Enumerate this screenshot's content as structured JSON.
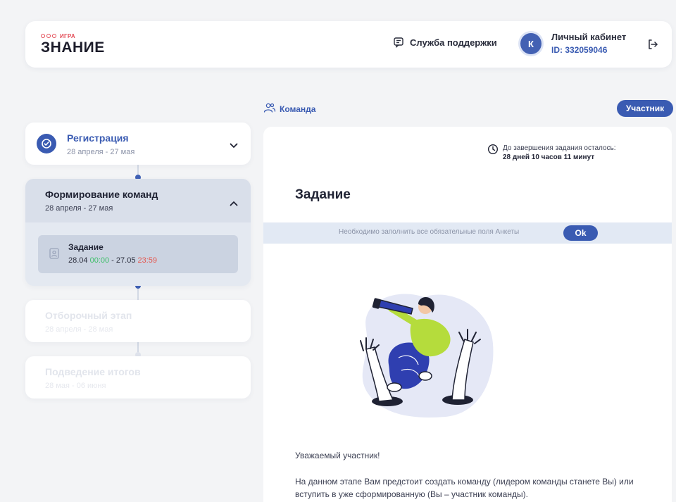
{
  "header": {
    "logo_top": "ИГРА",
    "logo_main": "ЗНАНИЕ",
    "support_label": "Служба поддержки",
    "avatar_initial": "К",
    "account_label": "Личный кабинет",
    "account_id": "ID: 332059046"
  },
  "sidebar": {
    "steps": [
      {
        "title": "Регистрация",
        "dates": "28 апреля - 27 мая",
        "state": "completed"
      },
      {
        "title": "Формирование команд",
        "dates": "28 апреля - 27 мая",
        "state": "active"
      },
      {
        "title": "Отборочный этап",
        "dates": "28 апреля - 28 мая",
        "state": "locked"
      },
      {
        "title": "Подведение итогов",
        "dates": "28 мая - 06 июня",
        "state": "locked"
      }
    ],
    "task": {
      "title": "Задание",
      "start_date": "28.04",
      "start_time": "00:00",
      "separator": " - ",
      "end_date": "27.05",
      "end_time": "23:59"
    }
  },
  "main": {
    "team_link": "Команда",
    "role_badge": "Участник",
    "timer_label": "До завершения задания осталось:",
    "timer_value": "28 дней 10 часов 11 минут",
    "title": "Задание",
    "notice": "Необходимо заполнить все обязательные поля Анкеты",
    "ok_label": "Ok",
    "greeting": "Уважаемый участник!",
    "description": "На данном этапе Вам предстоит создать команду (лидером команды станете Вы) или вступить в уже сформированную (Вы – участник команды)."
  },
  "colors": {
    "accent": "#3a5bb2",
    "logo_red": "#e34a55",
    "time_green": "#3fbf6a",
    "time_red": "#e5574f",
    "illustration_green": "#b5dc3c",
    "illustration_blue": "#2f3fb0"
  },
  "icons": [
    "chat-icon",
    "logout-icon",
    "check-icon",
    "chevron-down-icon",
    "chevron-up-icon",
    "task-icon",
    "team-icon",
    "clock-icon"
  ]
}
